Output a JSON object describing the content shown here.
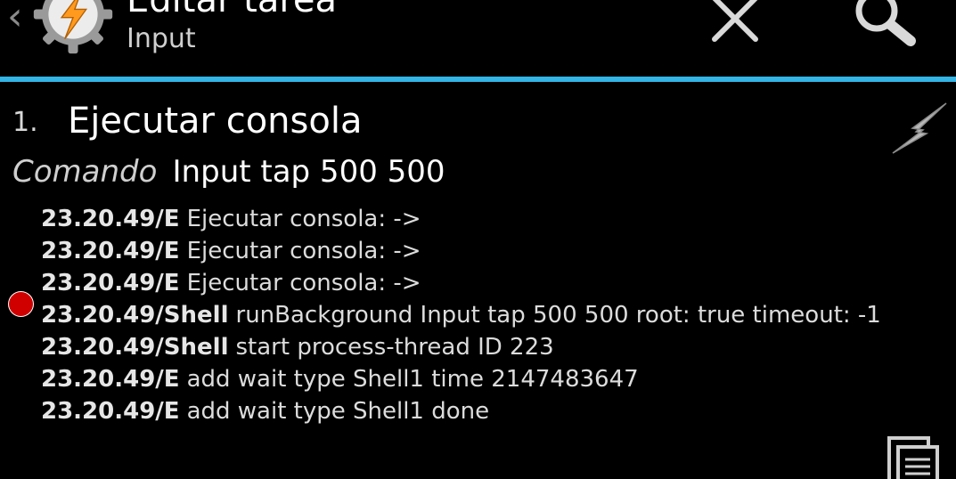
{
  "header": {
    "title": "Editar tarea",
    "subtitle": "Input",
    "icons": {
      "back": "chevron-left-icon",
      "app": "tasker-gear-lightning-icon",
      "close": "close-icon",
      "search": "search-icon"
    },
    "back_glyph": "‹"
  },
  "colors": {
    "accent": "#33b5e5",
    "background": "#000000",
    "breakpoint": "#d10000",
    "icon_orange": "#ff9a1f"
  },
  "action": {
    "number": "1.",
    "name": "Ejecutar consola",
    "param_label": "Comando",
    "param_value": "Input tap 500 500",
    "run_icon": "lightning-icon"
  },
  "log": [
    {
      "prefix": "23.20.49/E",
      "text": "Ejecutar consola:  ->"
    },
    {
      "prefix": "23.20.49/E",
      "text": "Ejecutar consola:  ->"
    },
    {
      "prefix": "23.20.49/E",
      "text": "Ejecutar consola:  ->"
    },
    {
      "prefix": "23.20.49/Shell",
      "text": "runBackground Input tap 500 500 root: true timeout: -1"
    },
    {
      "prefix": "23.20.49/Shell",
      "text": "start process-thread ID 223"
    },
    {
      "prefix": "23.20.49/E",
      "text": "add wait type Shell1 time 2147483647"
    },
    {
      "prefix": "23.20.49/E",
      "text": "add wait type Shell1 done"
    }
  ],
  "footer": {
    "doc_icon": "document-icon"
  }
}
